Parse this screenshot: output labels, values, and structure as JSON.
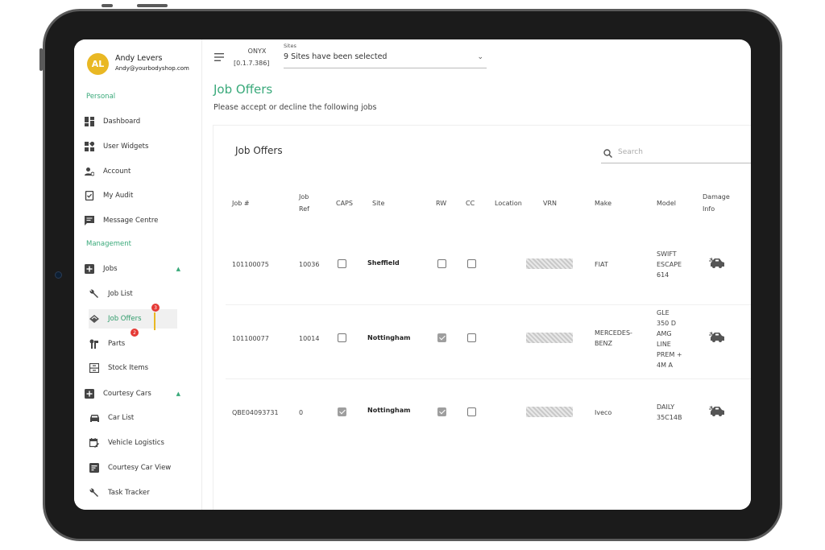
{
  "user": {
    "initials": "AL",
    "name": "Andy Levers",
    "email": "Andy@yourbodyshop.com"
  },
  "sidebar": {
    "personal_label": "Personal",
    "personal_items": [
      {
        "label": "Dashboard",
        "icon": "dashboard-icon"
      },
      {
        "label": "User Widgets",
        "icon": "widgets-icon"
      },
      {
        "label": "Account",
        "icon": "account-icon"
      },
      {
        "label": "My Audit",
        "icon": "audit-icon"
      },
      {
        "label": "Message Centre",
        "icon": "message-icon"
      }
    ],
    "management_label": "Management",
    "jobs_label": "Jobs",
    "jobs_items": [
      {
        "label": "Job List",
        "icon": "wrench-icon"
      },
      {
        "label": "Job Offers",
        "icon": "handshake-icon",
        "badge": "3"
      },
      {
        "label": "Parts",
        "icon": "parts-icon",
        "badge": "2"
      },
      {
        "label": "Stock Items",
        "icon": "stock-icon"
      }
    ],
    "courtesy_label": "Courtesy Cars",
    "courtesy_items": [
      {
        "label": "Car List",
        "icon": "car-icon"
      },
      {
        "label": "Vehicle Logistics",
        "icon": "calendar-edit-icon"
      },
      {
        "label": "Courtesy Car View",
        "icon": "document-icon"
      },
      {
        "label": "Task Tracker",
        "icon": "wrench-icon"
      }
    ]
  },
  "topbar": {
    "app_name": "ONYX",
    "version": "[0.1.7.386]",
    "sites_label": "Sites",
    "sites_value": "9 Sites have been selected"
  },
  "page": {
    "title": "Job Offers",
    "subtitle": "Please accept or decline the following jobs"
  },
  "card": {
    "title": "Job Offers",
    "search_placeholder": "Search"
  },
  "table": {
    "headers": {
      "job_no": "Job #",
      "job_ref_1": "Job",
      "job_ref_2": "Ref",
      "caps": "CAPS",
      "site": "Site",
      "rw": "RW",
      "cc": "CC",
      "location": "Location",
      "vrn": "VRN",
      "make": "Make",
      "model": "Model",
      "damage_1": "Damage",
      "damage_2": "Info"
    },
    "rows": [
      {
        "job_no": "101100075",
        "job_ref": "10036",
        "caps": false,
        "site": "Sheffield",
        "rw": false,
        "cc": false,
        "make_lines": [
          "FIAT"
        ],
        "model_lines": [
          "SWIFT",
          "ESCAPE",
          "614"
        ]
      },
      {
        "job_no": "101100077",
        "job_ref": "10014",
        "caps": false,
        "site": "Nottingham",
        "rw": true,
        "cc": false,
        "make_lines": [
          "MERCEDES-",
          "BENZ"
        ],
        "model_lines": [
          "GLE",
          "350 D",
          "AMG",
          "LINE",
          "PREM +",
          "4M A"
        ]
      },
      {
        "job_no": "QBE04093731",
        "job_ref": "0",
        "caps": true,
        "site": "Nottingham",
        "rw": true,
        "cc": false,
        "make_lines": [
          "Iveco"
        ],
        "model_lines": [
          "DAILY",
          "35C14B"
        ]
      }
    ]
  },
  "colors": {
    "accent_green": "#39a97a",
    "avatar_yellow": "#e9b824",
    "badge_red": "#e53935"
  }
}
